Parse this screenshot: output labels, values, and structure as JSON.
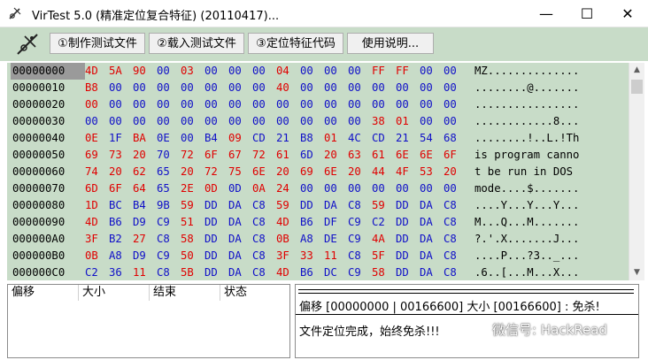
{
  "window": {
    "title": "VirTest 5.0 (精准定位复合特征) (20110417)...",
    "minimize_glyph": "—",
    "maximize_glyph": "☐",
    "close_glyph": "✕"
  },
  "toolbar": {
    "buttons": [
      {
        "label": "①制作测试文件"
      },
      {
        "label": "②载入测试文件"
      },
      {
        "label": "③定位特征代码"
      },
      {
        "label": "使用说明..."
      }
    ]
  },
  "colors": {
    "panel_bg": "#c8dcc8",
    "hex_red": "#e00000",
    "hex_blue": "#1010c8",
    "selected_addr_bg": "#9a9a9a"
  },
  "hex": {
    "rows": [
      {
        "addr": "00000000",
        "bytes": [
          "4D",
          "5A",
          "90",
          "00",
          "03",
          "00",
          "00",
          "00",
          "04",
          "00",
          "00",
          "00",
          "FF",
          "FF",
          "00",
          "00"
        ],
        "ascii": "MZ.............."
      },
      {
        "addr": "00000010",
        "bytes": [
          "B8",
          "00",
          "00",
          "00",
          "00",
          "00",
          "00",
          "00",
          "40",
          "00",
          "00",
          "00",
          "00",
          "00",
          "00",
          "00"
        ],
        "ascii": "........@......."
      },
      {
        "addr": "00000020",
        "bytes": [
          "00",
          "00",
          "00",
          "00",
          "00",
          "00",
          "00",
          "00",
          "00",
          "00",
          "00",
          "00",
          "00",
          "00",
          "00",
          "00"
        ],
        "ascii": "................"
      },
      {
        "addr": "00000030",
        "bytes": [
          "00",
          "00",
          "00",
          "00",
          "00",
          "00",
          "00",
          "00",
          "00",
          "00",
          "00",
          "00",
          "38",
          "01",
          "00",
          "00"
        ],
        "ascii": "............8..."
      },
      {
        "addr": "00000040",
        "bytes": [
          "0E",
          "1F",
          "BA",
          "0E",
          "00",
          "B4",
          "09",
          "CD",
          "21",
          "B8",
          "01",
          "4C",
          "CD",
          "21",
          "54",
          "68"
        ],
        "ascii": "........!..L.!Th"
      },
      {
        "addr": "00000050",
        "bytes": [
          "69",
          "73",
          "20",
          "70",
          "72",
          "6F",
          "67",
          "72",
          "61",
          "6D",
          "20",
          "63",
          "61",
          "6E",
          "6E",
          "6F"
        ],
        "ascii": "is program canno"
      },
      {
        "addr": "00000060",
        "bytes": [
          "74",
          "20",
          "62",
          "65",
          "20",
          "72",
          "75",
          "6E",
          "20",
          "69",
          "6E",
          "20",
          "44",
          "4F",
          "53",
          "20"
        ],
        "ascii": "t be run in DOS "
      },
      {
        "addr": "00000070",
        "bytes": [
          "6D",
          "6F",
          "64",
          "65",
          "2E",
          "0D",
          "0D",
          "0A",
          "24",
          "00",
          "00",
          "00",
          "00",
          "00",
          "00",
          "00"
        ],
        "ascii": "mode....$......."
      },
      {
        "addr": "00000080",
        "bytes": [
          "1D",
          "BC",
          "B4",
          "9B",
          "59",
          "DD",
          "DA",
          "C8",
          "59",
          "DD",
          "DA",
          "C8",
          "59",
          "DD",
          "DA",
          "C8"
        ],
        "ascii": "....Y...Y...Y..."
      },
      {
        "addr": "00000090",
        "bytes": [
          "4D",
          "B6",
          "D9",
          "C9",
          "51",
          "DD",
          "DA",
          "C8",
          "4D",
          "B6",
          "DF",
          "C9",
          "C2",
          "DD",
          "DA",
          "C8"
        ],
        "ascii": "M...Q...M......."
      },
      {
        "addr": "000000A0",
        "bytes": [
          "3F",
          "B2",
          "27",
          "C8",
          "58",
          "DD",
          "DA",
          "C8",
          "0B",
          "A8",
          "DE",
          "C9",
          "4A",
          "DD",
          "DA",
          "C8"
        ],
        "ascii": "?.'.X.......J..."
      },
      {
        "addr": "000000B0",
        "bytes": [
          "0B",
          "A8",
          "D9",
          "C9",
          "50",
          "DD",
          "DA",
          "C8",
          "3F",
          "33",
          "11",
          "C8",
          "5F",
          "DD",
          "DA",
          "C8"
        ],
        "ascii": "....P...?3.._..."
      },
      {
        "addr": "000000C0",
        "bytes": [
          "C2",
          "36",
          "11",
          "C8",
          "5B",
          "DD",
          "DA",
          "C8",
          "4D",
          "B6",
          "DC",
          "C9",
          "58",
          "DD",
          "DA",
          "C8"
        ],
        "ascii": ".6..[...M...X..."
      }
    ],
    "byte_colors": [
      [
        "r",
        "r",
        "r",
        "b",
        "r",
        "b",
        "b",
        "b",
        "r",
        "b",
        "b",
        "b",
        "r",
        "r",
        "b",
        "b"
      ],
      [
        "r",
        "b",
        "b",
        "b",
        "b",
        "b",
        "b",
        "b",
        "r",
        "b",
        "b",
        "b",
        "b",
        "b",
        "b",
        "b"
      ],
      [
        "r",
        "b",
        "b",
        "b",
        "b",
        "b",
        "b",
        "b",
        "b",
        "b",
        "b",
        "b",
        "b",
        "b",
        "b",
        "b"
      ],
      [
        "b",
        "b",
        "b",
        "b",
        "b",
        "b",
        "b",
        "b",
        "b",
        "b",
        "b",
        "b",
        "r",
        "r",
        "b",
        "b"
      ],
      [
        "r",
        "b",
        "r",
        "b",
        "b",
        "b",
        "r",
        "b",
        "b",
        "b",
        "r",
        "b",
        "b",
        "b",
        "b",
        "b"
      ],
      [
        "r",
        "r",
        "r",
        "b",
        "r",
        "r",
        "r",
        "r",
        "r",
        "b",
        "r",
        "r",
        "r",
        "r",
        "r",
        "r"
      ],
      [
        "r",
        "r",
        "r",
        "b",
        "r",
        "r",
        "r",
        "r",
        "r",
        "r",
        "r",
        "r",
        "r",
        "r",
        "r",
        "r"
      ],
      [
        "r",
        "r",
        "r",
        "b",
        "r",
        "r",
        "b",
        "r",
        "r",
        "b",
        "b",
        "b",
        "b",
        "b",
        "b",
        "b"
      ],
      [
        "r",
        "b",
        "b",
        "b",
        "r",
        "b",
        "b",
        "b",
        "r",
        "b",
        "b",
        "b",
        "r",
        "b",
        "b",
        "b"
      ],
      [
        "r",
        "b",
        "b",
        "b",
        "r",
        "b",
        "b",
        "b",
        "r",
        "b",
        "b",
        "b",
        "b",
        "b",
        "b",
        "b"
      ],
      [
        "r",
        "b",
        "r",
        "b",
        "r",
        "b",
        "b",
        "b",
        "r",
        "b",
        "b",
        "b",
        "r",
        "b",
        "b",
        "b"
      ],
      [
        "r",
        "b",
        "b",
        "b",
        "r",
        "b",
        "b",
        "b",
        "r",
        "r",
        "r",
        "b",
        "r",
        "b",
        "b",
        "b"
      ],
      [
        "b",
        "b",
        "r",
        "b",
        "r",
        "b",
        "b",
        "b",
        "r",
        "b",
        "b",
        "b",
        "r",
        "b",
        "b",
        "b"
      ]
    ]
  },
  "list_panel": {
    "columns": [
      "偏移",
      "大小",
      "结束",
      "状态"
    ]
  },
  "info_panel": {
    "info_line": "偏移 [00000000 | 00166600] 大小 [00166600] : 免杀!",
    "result_line": "文件定位完成，始终免杀!!!"
  },
  "watermark": {
    "text": "微信号: HackRead"
  }
}
